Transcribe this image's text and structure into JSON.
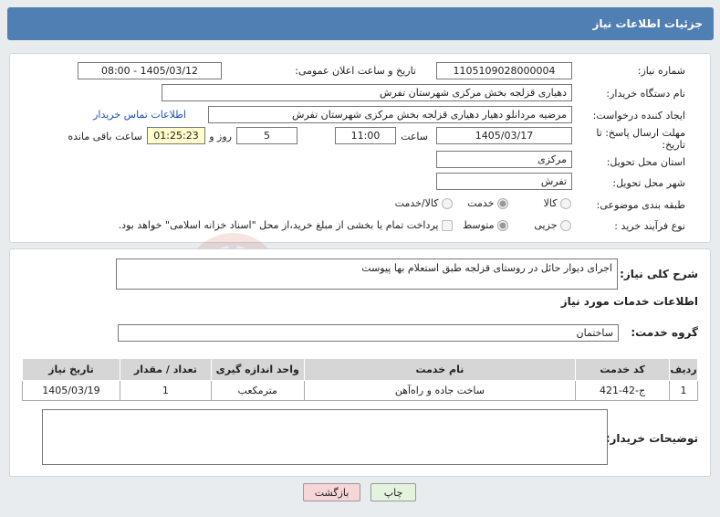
{
  "header": {
    "title": "جزئیات اطلاعات نیاز"
  },
  "fields": {
    "need_number_label": "شماره نیاز:",
    "need_number": "1105109028000004",
    "announce_label": "تاریخ و ساعت اعلان عمومی:",
    "announce_value": "1405/03/12 - 08:00",
    "buyer_org_label": "نام دستگاه خریدار:",
    "buyer_org": "دهیاری قزلجه بخش مرکزی شهرستان تفرش",
    "requester_label": "ایجاد کننده درخواست:",
    "requester": "مرضیه مردانلو دهیار دهیاری قزلجه بخش مرکزی شهرستان تفرش",
    "contact_link": "اطلاعات تماس خریدار",
    "deadline_label": "مهلت ارسال پاسخ: تا تاریخ:",
    "deadline_date": "1405/03/17",
    "time_label": "ساعت",
    "deadline_time": "11:00",
    "days_value": "5",
    "days_label": "روز و",
    "remaining_time": "01:25:23",
    "remaining_label": "ساعت باقی مانده",
    "province_label": "استان محل تحویل:",
    "province": "مرکزی",
    "city_label": "شهر محل تحویل:",
    "city": "تفرش",
    "category_label": "طبقه بندی موضوعی:",
    "category_options": [
      "کالا",
      "خدمت",
      "کالا/خدمت"
    ],
    "category_selected": "خدمت",
    "process_label": "نوع فرآیند خرید :",
    "process_options": [
      "جزیی",
      "متوسط"
    ],
    "process_selected": "متوسط",
    "payment_note": "پرداخت تمام یا بخشی از مبلغ خرید،از محل \"اسناد خزانه اسلامی\" خواهد بود."
  },
  "description": {
    "label": "شرح کلی نیاز:",
    "text": "اجرای دیوار حائل در روستای قزلجه طبق استعلام بها پیوست"
  },
  "services": {
    "section_title": "اطلاعات خدمات مورد نیاز",
    "group_label": "گروه خدمت:",
    "group_value": "ساختمان",
    "columns": [
      "ردیف",
      "کد خدمت",
      "نام خدمت",
      "واحد اندازه گیری",
      "تعداد / مقدار",
      "تاریخ نیاز"
    ],
    "rows": [
      {
        "row": "1",
        "code": "ج-42-421",
        "name": "ساخت جاده و راه‌آهن",
        "unit": "مترمکعب",
        "qty": "1",
        "date": "1405/03/19"
      }
    ]
  },
  "buyer_notes": {
    "label": "توضیحات خریدار:",
    "value": ""
  },
  "buttons": {
    "print": "چاپ",
    "back": "بازگشت"
  },
  "watermark": {
    "text": "AriaTender.net"
  },
  "colors": {
    "header": "#4f7fb3",
    "remaining_bg": "#ffffcc",
    "link": "#1a4fb8"
  }
}
